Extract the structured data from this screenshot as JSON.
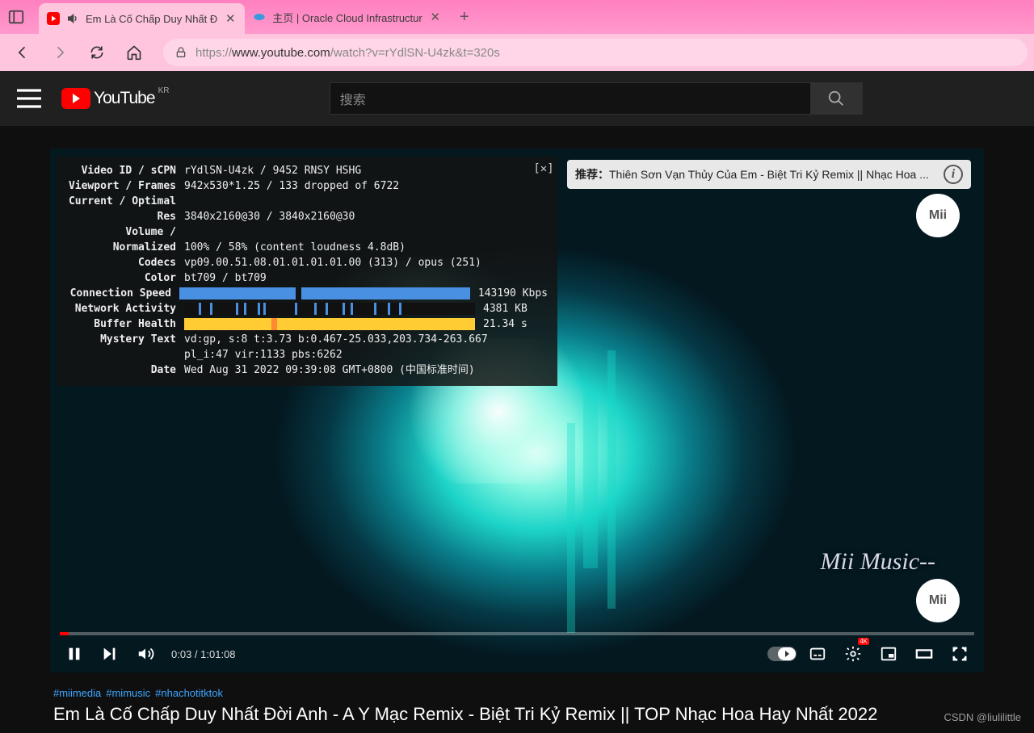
{
  "browser": {
    "tabs": [
      {
        "title": "Em Là Cố Chấp Duy Nhất Đ",
        "icon": "youtube",
        "active": true,
        "audio": true
      },
      {
        "title": "主页 | Oracle Cloud Infrastructur",
        "icon": "oracle",
        "active": false
      }
    ],
    "url_prefix": "https://",
    "url_host": "www.youtube.com",
    "url_path": "/watch?v=rYdlSN-U4zk&t=320s"
  },
  "youtube": {
    "region": "KR",
    "logo_text": "YouTube",
    "search_placeholder": "搜索"
  },
  "recommendation": {
    "prefix": "推荐：",
    "text": "Thiên Sơn Vạn Thủy Của Em - Biệt Tri Kỷ Remix || Nhạc Hoa ..."
  },
  "stats": {
    "rows": [
      {
        "label": "Video ID / sCPN",
        "value": "rYdlSN-U4zk  / 9452 RNSY HSHG"
      },
      {
        "label": "Viewport / Frames",
        "value": "942x530*1.25 / 133 dropped of 6722"
      },
      {
        "label": "Current / Optimal",
        "value": ""
      },
      {
        "label": "Res",
        "value": "3840x2160@30 / 3840x2160@30"
      },
      {
        "label": "Volume /",
        "value": ""
      },
      {
        "label": "Normalized",
        "value": "100% / 58% (content loudness 4.8dB)"
      },
      {
        "label": "Codecs",
        "value": "vp09.00.51.08.01.01.01.01.00 (313) / opus (251)"
      },
      {
        "label": "Color",
        "value": "bt709 / bt709"
      }
    ],
    "conn_speed_label": "Connection Speed",
    "conn_speed_value": "143190 Kbps",
    "net_activity_label": "Network Activity",
    "net_activity_value": "4381 KB",
    "buffer_label": "Buffer Health",
    "buffer_value": "21.34 s",
    "mystery_label": "Mystery Text",
    "mystery_value1": "vd:gp, s:8 t:3.73 b:0.467-25.033,203.734-263.667",
    "mystery_value2": "pl_i:47 vir:1133 pbs:6262",
    "date_label": "Date",
    "date_value": "Wed Aug 31 2022 09:39:08 GMT+0800 (中国标准时间)"
  },
  "player": {
    "time_current": "0:03",
    "time_total": "1:01:08",
    "quality_badge": "4K",
    "watermark": "Mii Music--",
    "channel_badge": "Mii"
  },
  "description": {
    "hashtags": [
      "#miimedia",
      "#mimusic",
      "#nhachotitktok"
    ],
    "title": "Em Là Cố Chấp Duy Nhất Đời Anh - A Y Mạc Remix - Biệt Tri Kỷ Remix || TOP Nhạc Hoa Hay Nhất 2022"
  },
  "csdn": "CSDN @liulilittle"
}
